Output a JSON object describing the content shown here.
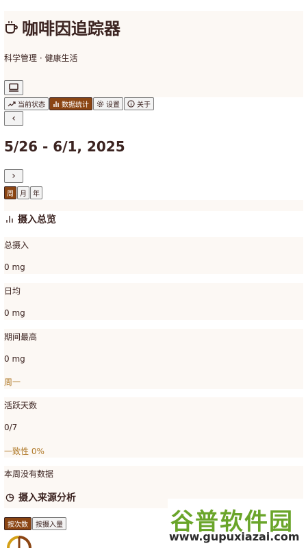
{
  "app": {
    "title": "咖啡因追踪器",
    "subtitle": "科学管理 · 健康生活"
  },
  "tabs": [
    {
      "label": "当前状态",
      "icon": "trend-icon",
      "active": false
    },
    {
      "label": "数据统计",
      "icon": "bar-chart-icon",
      "active": true
    },
    {
      "label": "设置",
      "icon": "gear-icon",
      "active": false
    },
    {
      "label": "关于",
      "icon": "info-icon",
      "active": false
    }
  ],
  "navigation": {
    "date_range": "5/26 - 6/1, 2025",
    "prev_symbol": "‹",
    "next_symbol": "›"
  },
  "period": [
    {
      "label": "周",
      "active": true
    },
    {
      "label": "月",
      "active": false
    },
    {
      "label": "年",
      "active": false
    }
  ],
  "overview": {
    "title": "摄入总览",
    "total_label": "总摄入",
    "total_value": "0 mg",
    "daily_label": "日均",
    "daily_value": "0 mg",
    "max_label": "期间最高",
    "max_value": "0 mg",
    "max_day": "周一",
    "active_label": "活跃天数",
    "active_value": "0/7",
    "consistency": "一致性 0%"
  },
  "empty_message": "本周没有数据",
  "source": {
    "title": "摄入来源分析",
    "toggle": [
      {
        "label": "按次数",
        "active": true
      },
      {
        "label": "按摄入量",
        "active": false
      }
    ]
  },
  "watermark": {
    "top": "谷普软件园",
    "bottom": "www.gupuxiazai.com"
  },
  "colors": {
    "accent": "#8b4513",
    "text": "#3b2320",
    "panel": "#fcf8f4",
    "note": "#b07a2a"
  }
}
